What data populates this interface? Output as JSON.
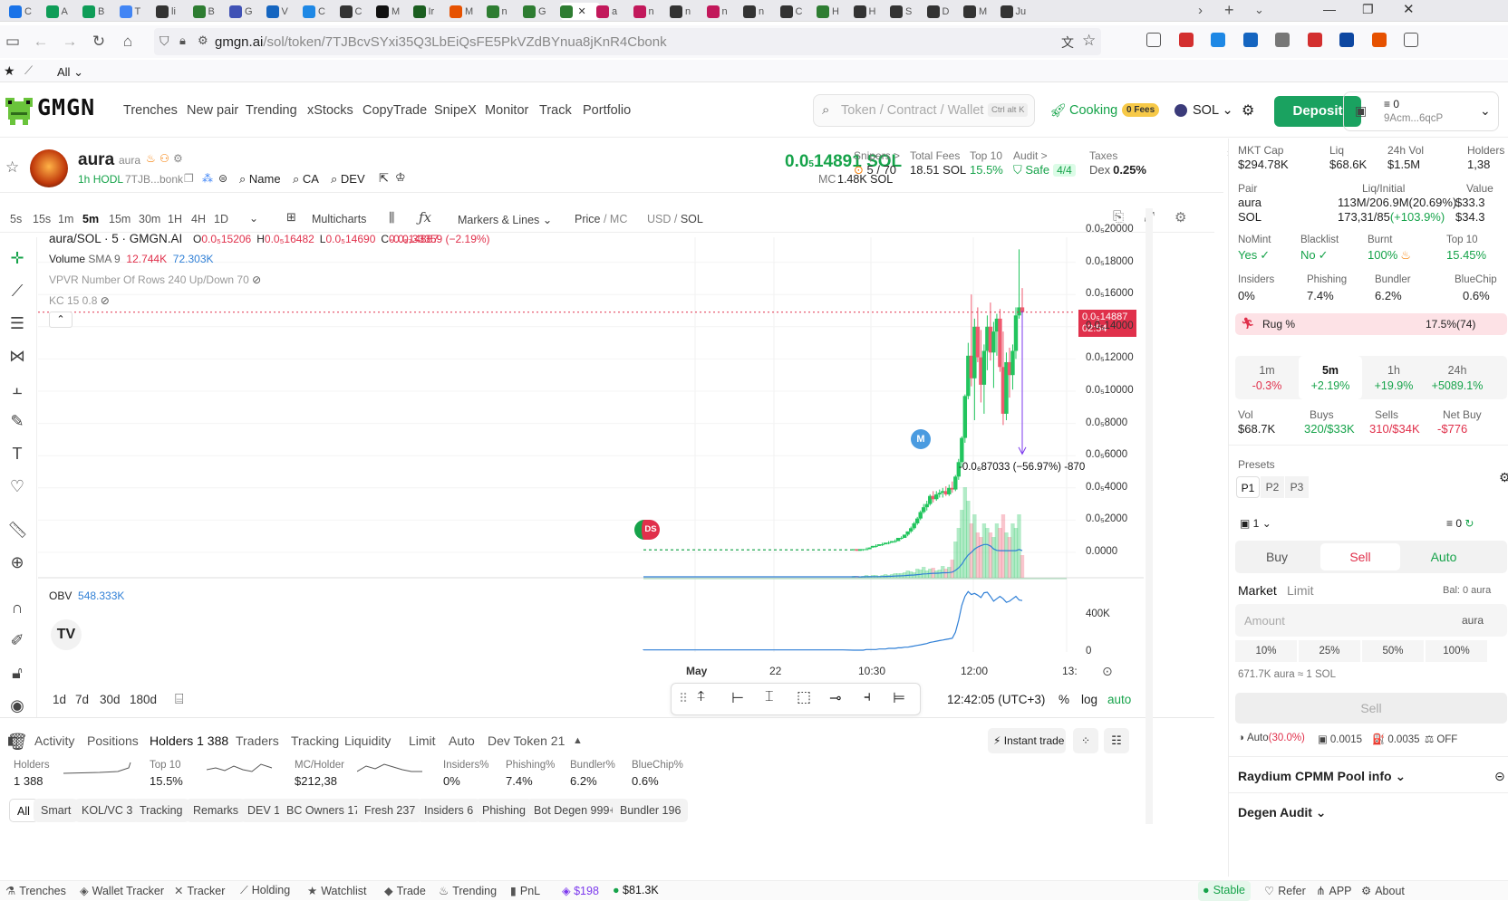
{
  "browser": {
    "tabs": [
      {
        "label": "C",
        "color": "#1a73e8"
      },
      {
        "label": "A",
        "color": "#0f9d58"
      },
      {
        "label": "B",
        "color": "#0f9d58"
      },
      {
        "label": "T",
        "color": "#4285f4"
      },
      {
        "label": "li",
        "color": "#333"
      },
      {
        "label": "B",
        "color": "#2e7d32"
      },
      {
        "label": "G",
        "color": "#3f51b5"
      },
      {
        "label": "V",
        "color": "#1565c0"
      },
      {
        "label": "C",
        "color": "#1e88e5"
      },
      {
        "label": "C",
        "color": "#333"
      },
      {
        "label": "M",
        "color": "#111"
      },
      {
        "label": "Ir",
        "color": "#1b5e20"
      },
      {
        "label": "M",
        "color": "#e65100"
      },
      {
        "label": "n",
        "color": "#2e7d32"
      },
      {
        "label": "G",
        "color": "#2e7d32"
      },
      {
        "label": "",
        "color": "#2e7d32"
      },
      {
        "label": "a",
        "color": "#c2185b"
      },
      {
        "label": "n",
        "color": "#c2185b"
      },
      {
        "label": "n",
        "color": "#333"
      },
      {
        "label": "n",
        "color": "#c2185b"
      },
      {
        "label": "n",
        "color": "#333"
      },
      {
        "label": "C",
        "color": "#333"
      },
      {
        "label": "H",
        "color": "#2e7d32"
      },
      {
        "label": "H",
        "color": "#333"
      },
      {
        "label": "S",
        "color": "#333"
      },
      {
        "label": "D",
        "color": "#333"
      },
      {
        "label": "M",
        "color": "#333"
      },
      {
        "label": "Ju",
        "color": "#333"
      }
    ],
    "url_host": "gmgn.ai",
    "url_path": "/sol/token/7TJBcvSYxi35Q3LbEiQsFE5PkVZdBYnua8jKnR4Cbonk",
    "bookmarks_all": "All"
  },
  "nav": {
    "logo": "GMGN",
    "items": [
      "Trenches",
      "New pair",
      "Trending",
      "xStocks",
      "CopyTrade",
      "SnipeX",
      "Monitor",
      "Track",
      "Portfolio"
    ],
    "search_placeholder": "Token / Contract / Wallet",
    "search_shortcut": "Ctrl alt K",
    "cooking": "Cooking",
    "fees_badge": "0 Fees",
    "chain": "SOL",
    "deposit": "Deposit",
    "wallet_balance": "0",
    "wallet_addr": "9Acm...6qcP"
  },
  "token": {
    "name": "aura",
    "ticker": "aura",
    "age": "1h",
    "hodl": "HODL",
    "ca_short": "7TJB...bonk",
    "links": [
      "Name",
      "CA",
      "DEV"
    ],
    "price_prefix": "0.0",
    "price_sub": "5",
    "price_rest": "14891 SOL",
    "mc_label": "MC",
    "mc_value": "1.48K SOL",
    "stats": [
      {
        "label": "Snipers >",
        "value": "5 / 70"
      },
      {
        "label": "Total Fees",
        "value": "18.51 SOL"
      },
      {
        "label": "Top 10",
        "value": "15.5%"
      },
      {
        "label": "Audit >",
        "value": "Safe",
        "badge": "4/4"
      },
      {
        "label": "Taxes",
        "value": "Dex",
        "value2": "0.25%"
      }
    ]
  },
  "chart_toolbar": {
    "intervals": [
      "5s",
      "15s",
      "1m",
      "5m",
      "15m",
      "30m",
      "1H",
      "4H",
      "1D"
    ],
    "active_interval": "5m",
    "multicharts": "Multicharts",
    "markers": "Markers & Lines",
    "price": "Price",
    "mc": "MC",
    "usd": "USD",
    "sol": "SOL"
  },
  "chart_legend": {
    "pair": "aura/SOL · 5 · GMGN.AI",
    "ohlc": [
      {
        "k": "O",
        "v": "0.0₅15206"
      },
      {
        "k": "H",
        "v": "0.0₅16482"
      },
      {
        "k": "L",
        "v": "0.0₅14690"
      },
      {
        "k": "C",
        "v": "0.0₅14887"
      }
    ],
    "change": "-0.0₇33359 (−2.19%)",
    "volume": "Volume",
    "sma": "SMA 9",
    "vol1": "12.744K",
    "vol2": "72.303K",
    "vpvr": "VPVR Number Of Rows 240 Up/Down 70",
    "kc": "KC 15 0.8",
    "obv": "OBV",
    "obv_value": "548.333K",
    "measure_label": "-0.0₆87033 (−56.97%) -870",
    "marker_m": "M",
    "marker_ds": "DS",
    "live_price": "0.0₅14887",
    "countdown": "02:54"
  },
  "chart_data": {
    "type": "candlestick",
    "ylim": [
      0,
      2e-06
    ],
    "y_ticks": [
      "0.0₅20000",
      "0.0₅18000",
      "0.0₅16000",
      "0.0₅14000",
      "0.0₅12000",
      "0.0₅10000",
      "0.0₅8000",
      "0.0₅6000",
      "0.0₅4000",
      "0.0₅2000",
      "0.0000"
    ],
    "y_tick_values": [
      2e-06,
      1.8e-06,
      1.6e-06,
      1.4e-06,
      1.2e-06,
      1e-06,
      8e-07,
      6e-07,
      4e-07,
      2e-07,
      0
    ],
    "obv_ticks": [
      "400K",
      "0"
    ],
    "x_ticks": [
      "May",
      "22",
      "10:30",
      "12:00",
      "13:"
    ],
    "ohlc": [
      [
        2e-08,
        2e-08,
        1e-08,
        2e-08
      ],
      [
        2e-08,
        2e-08,
        1e-08,
        1e-08
      ],
      [
        1e-08,
        2e-08,
        1e-08,
        2e-08
      ],
      [
        2e-08,
        2e-08,
        1e-08,
        2e-08
      ],
      [
        2e-08,
        3e-08,
        2e-08,
        2e-08
      ],
      [
        2e-08,
        3e-08,
        2e-08,
        3e-08
      ],
      [
        3e-08,
        4e-08,
        3e-08,
        4e-08
      ],
      [
        4e-08,
        5e-08,
        3e-08,
        4e-08
      ],
      [
        4e-08,
        5e-08,
        4e-08,
        5e-08
      ],
      [
        5e-08,
        6e-08,
        4e-08,
        5e-08
      ],
      [
        5e-08,
        6e-08,
        5e-08,
        6e-08
      ],
      [
        6e-08,
        7e-08,
        5e-08,
        6e-08
      ],
      [
        6e-08,
        7e-08,
        6e-08,
        7e-08
      ],
      [
        7e-08,
        8e-08,
        6e-08,
        7e-08
      ],
      [
        7e-08,
        9e-08,
        7e-08,
        9e-08
      ],
      [
        9e-08,
        1e-07,
        8e-08,
        9e-08
      ],
      [
        9e-08,
        1.1e-07,
        9e-08,
        1.1e-07
      ],
      [
        1.1e-07,
        1.3e-07,
        1e-07,
        1.3e-07
      ],
      [
        1.3e-07,
        1.6e-07,
        1.2e-07,
        1.5e-07
      ],
      [
        1.5e-07,
        1.9e-07,
        1.4e-07,
        1.8e-07
      ],
      [
        1.8e-07,
        2.2e-07,
        1.7e-07,
        2.1e-07
      ],
      [
        2.1e-07,
        2.6e-07,
        2e-07,
        2.5e-07
      ],
      [
        2.5e-07,
        3e-07,
        2.4e-07,
        2.8e-07
      ],
      [
        2.8e-07,
        3.2e-07,
        2.6e-07,
        3e-07
      ],
      [
        3e-07,
        3.6e-07,
        2.9e-07,
        3.5e-07
      ],
      [
        3.5e-07,
        3.8e-07,
        3.1e-07,
        3.3e-07
      ],
      [
        3.3e-07,
        3.8e-07,
        3.2e-07,
        3.6e-07
      ],
      [
        3.6e-07,
        3.9e-07,
        3.4e-07,
        3.7e-07
      ],
      [
        3.7e-07,
        4e-07,
        3.4e-07,
        3.8e-07
      ],
      [
        3.8e-07,
        4.1e-07,
        3.5e-07,
        3.6e-07
      ],
      [
        3.6e-07,
        4.2e-07,
        3.5e-07,
        4e-07
      ],
      [
        4e-07,
        4.4e-07,
        3.7e-07,
        3.9e-07
      ],
      [
        3.9e-07,
        4.8e-07,
        3.8e-07,
        4.7e-07
      ],
      [
        4.7e-07,
        5.8e-07,
        4.5e-07,
        5.6e-07
      ],
      [
        5.6e-07,
        7.2e-07,
        5.3e-07,
        7.1e-07
      ],
      [
        7.1e-07,
        9.8e-07,
        6.8e-07,
        9.7e-07
      ],
      [
        9.7e-07,
        1.3e-06,
        9.5e-07,
        1.22e-06
      ],
      [
        1.22e-06,
        1.6e-06,
        1.03e-06,
        1.08e-06
      ],
      [
        1.08e-06,
        1.45e-06,
        8.2e-07,
        1.4e-06
      ],
      [
        1.4e-06,
        1.52e-06,
        1.18e-06,
        1.21e-06
      ],
      [
        1.21e-06,
        1.38e-06,
        9.3e-07,
        1.04e-06
      ],
      [
        1.04e-06,
        1.29e-06,
        8.6e-07,
        1.25e-06
      ],
      [
        1.25e-06,
        1.47e-06,
        1.13e-06,
        1.4e-06
      ],
      [
        1.4e-06,
        1.55e-06,
        1.19e-06,
        1.24e-06
      ],
      [
        1.24e-06,
        1.43e-06,
        1.02e-06,
        1.37e-06
      ],
      [
        1.37e-06,
        1.48e-06,
        1.22e-06,
        1.45e-06
      ],
      [
        1.45e-06,
        1.51e-06,
        1.12e-06,
        1.15e-06
      ],
      [
        1.15e-06,
        1.37e-06,
        7.9e-07,
        8.6e-07
      ],
      [
        8.6e-07,
        1.24e-06,
        8.2e-07,
        1.18e-06
      ],
      [
        1.18e-06,
        1.27e-06,
        9.6e-07,
        1.1e-06
      ],
      [
        1.1e-06,
        1.29e-06,
        1.01e-06,
        1.25e-06
      ],
      [
        1.25e-06,
        1.52e-06,
        1.2e-06,
        1.47e-06
      ],
      [
        1.47e-06,
        1.88e-06,
        1.45e-06,
        1.52e-06
      ],
      [
        1.52e-06,
        1.64e-06,
        1.44e-06,
        1.49e-06
      ]
    ],
    "volume_rel": [
      0.02,
      0.02,
      0.01,
      0.02,
      0.03,
      0.02,
      0.03,
      0.03,
      0.02,
      0.03,
      0.04,
      0.03,
      0.04,
      0.05,
      0.05,
      0.05,
      0.06,
      0.08,
      0.07,
      0.06,
      0.1,
      0.09,
      0.12,
      0.08,
      0.1,
      0.11,
      0.08,
      0.09,
      0.13,
      0.1,
      0.12,
      0.2,
      0.4,
      0.55,
      0.75,
      1.0,
      0.85,
      0.6,
      0.7,
      0.5,
      0.45,
      0.6,
      0.55,
      0.5,
      0.45,
      0.6,
      0.55,
      0.7,
      0.5,
      0.45,
      0.6,
      0.55,
      0.7,
      0.25
    ],
    "obv_rel": [
      0.0,
      0.0,
      0.0,
      0.0,
      0.01,
      0.01,
      0.01,
      0.01,
      0.02,
      0.02,
      0.02,
      0.03,
      0.03,
      0.03,
      0.04,
      0.04,
      0.05,
      0.05,
      0.06,
      0.07,
      0.08,
      0.09,
      0.1,
      0.11,
      0.13,
      0.14,
      0.15,
      0.16,
      0.17,
      0.18,
      0.19,
      0.2,
      0.3,
      0.5,
      0.75,
      0.9,
      0.98,
      0.93,
      0.95,
      0.92,
      0.88,
      0.96,
      0.97,
      0.9,
      0.82,
      0.86,
      0.9,
      0.86,
      0.8,
      0.82,
      0.86,
      0.9,
      0.84,
      0.83
    ]
  },
  "chart_bottom": {
    "ranges": [
      "1d",
      "7d",
      "30d",
      "180d"
    ],
    "time": "12:42:05 (UTC+3)",
    "pct": "%",
    "log": "log",
    "auto": "auto"
  },
  "bottom_tabs": {
    "tabs": [
      "Activity",
      "Positions",
      "Holders 1 388",
      "Traders",
      "Tracking",
      "Liquidity",
      "Limit",
      "Auto",
      "Dev Token 21"
    ],
    "active": "Holders 1 388",
    "instant": "Instant trade",
    "metrics": [
      {
        "label": "Holders",
        "value": "1 388"
      },
      {
        "label": "Top 10",
        "value": "15.5%"
      },
      {
        "label": "MC/Holder",
        "value": "$212,38"
      },
      {
        "label": "Insiders%",
        "value": "0%"
      },
      {
        "label": "Phishing%",
        "value": "7.4%"
      },
      {
        "label": "Bundler%",
        "value": "6.2%"
      },
      {
        "label": "BlueChip%",
        "value": "0.6%"
      }
    ],
    "filters": [
      "All",
      "Smart",
      "KOL/VC 3",
      "Tracking",
      "Remarks",
      "DEV 1",
      "BC Owners 17",
      "Fresh 237",
      "Insiders 6",
      "Phishing",
      "Bot Degen 999+",
      "Bundler 196"
    ]
  },
  "status_bar": {
    "items": [
      "Trenches",
      "Wallet Tracker",
      "Tracker",
      "Holding",
      "Watchlist",
      "Trade",
      "Trending",
      "PnL"
    ],
    "sol_price": "$198",
    "btc_price": "$81.3K",
    "right": [
      "Stable",
      "Refer",
      "APP",
      "About"
    ]
  },
  "right_panel": {
    "top_stats": [
      {
        "label": "MKT Cap",
        "value": "$294.78K"
      },
      {
        "label": "Liq",
        "value": "$68.6K"
      },
      {
        "label": "24h Vol",
        "value": "$1.5M"
      },
      {
        "label": "Holders",
        "value": "1,38"
      }
    ],
    "pair_label": "Pair",
    "liq_initial_label": "Liq/Initial",
    "value_label": "Value",
    "pair_rows": [
      {
        "name": "aura",
        "liq": "113M/206.9M(20.69%)",
        "value": "$33.3"
      },
      {
        "name": "SOL",
        "liq": "173,31/85",
        "change": "(+103.9%)",
        "value": "$34.3"
      }
    ],
    "security": [
      {
        "label": "NoMint",
        "value": "Yes"
      },
      {
        "label": "Blacklist",
        "value": "No"
      },
      {
        "label": "Burnt",
        "value": "100%"
      },
      {
        "label": "Top 10",
        "value": "15.45%"
      }
    ],
    "security2": [
      {
        "label": "Insiders",
        "value": "0%"
      },
      {
        "label": "Phishing",
        "value": "7.4%"
      },
      {
        "label": "Bundler",
        "value": "6.2%"
      },
      {
        "label": "BlueChip",
        "value": "0.6%"
      }
    ],
    "rug_label": "Rug %",
    "rug_value": "17.5%(74)",
    "timeframes": [
      {
        "label": "1m",
        "value": "-0.3%"
      },
      {
        "label": "5m",
        "value": "+2.19%"
      },
      {
        "label": "1h",
        "value": "+19.9%"
      },
      {
        "label": "24h",
        "value": "+5089.1%"
      }
    ],
    "trade_stats": [
      {
        "label": "Vol",
        "value": "$68.7K"
      },
      {
        "label": "Buys",
        "value": "320/$33K"
      },
      {
        "label": "Sells",
        "value": "310/$34K"
      },
      {
        "label": "Net Buy",
        "value": "-$776"
      }
    ],
    "presets_label": "Presets",
    "presets": [
      "P1",
      "P2",
      "P3"
    ],
    "wallet_count": "1",
    "balance": "0",
    "modes": [
      "Buy",
      "Sell",
      "Auto"
    ],
    "order_types": [
      "Market",
      "Limit"
    ],
    "bal_label": "Bal: 0 aura",
    "amount_placeholder": "Amount",
    "amount_unit": "aura",
    "percents": [
      "10%",
      "25%",
      "50%",
      "100%"
    ],
    "conversion": "671.7K aura ≈ 1 SOL",
    "sell_button": "Sell",
    "settings": [
      {
        "label": "Auto",
        "value": "(30.0%)"
      },
      {
        "label": "",
        "value": "0.0015"
      },
      {
        "label": "",
        "value": "0.0035"
      },
      {
        "label": "",
        "value": "OFF"
      }
    ],
    "pool_info": "Raydium CPMM Pool info",
    "degen_audit": "Degen Audit"
  }
}
